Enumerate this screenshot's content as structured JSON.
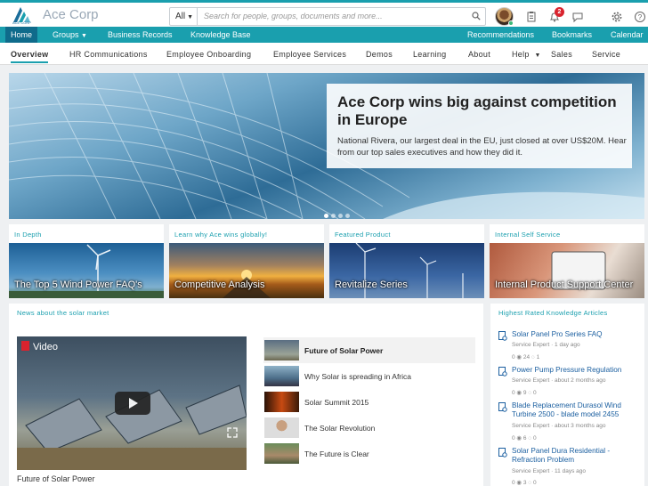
{
  "header": {
    "logo_sub": "ACE CORP",
    "brand": "Ace Corp",
    "search_scope": "All",
    "search_placeholder": "Search for people, groups, documents and more...",
    "notifications_count": "2",
    "accent": "#1a9fae"
  },
  "navbar": {
    "items": [
      "Home",
      "Groups",
      "Business Records",
      "Knowledge Base",
      "Recommendations",
      "Bookmarks",
      "Calendar"
    ]
  },
  "subnav": {
    "items": [
      "Overview",
      "HR Communications",
      "Employee Onboarding",
      "Employee Services",
      "Demos",
      "Learning",
      "About",
      "Help",
      "Sales",
      "Service"
    ]
  },
  "hero": {
    "title": "Ace Corp wins big against competition in Europe",
    "text": "National Rivera, our largest deal in the EU, just closed at over US$20M. Hear from our top sales executives and how they did it."
  },
  "tiles": [
    {
      "heading": "In Depth",
      "caption": "The Top 5 Wind Power FAQ's"
    },
    {
      "heading": "Learn why Ace wins globally!",
      "caption": "Competitive Analysis"
    },
    {
      "heading": "Featured Product",
      "caption": "Revitalize Series"
    },
    {
      "heading": "Internal Self Service",
      "caption": "Internal Product Support Center"
    }
  ],
  "news": {
    "title": "News about the solar market",
    "video_label": "Video",
    "video_caption": "Future of Solar Power",
    "videos": [
      "Future of Solar Power",
      "Why Solar is spreading in Africa",
      "Solar Summit 2015",
      "The Solar Revolution",
      "The Future is Clear"
    ]
  },
  "knowledge": {
    "title": "Highest Rated Knowledge Articles",
    "articles": [
      {
        "title": "Solar Panel Pro Series FAQ",
        "meta": "Service Expert · 1 day ago",
        "stats": "0 ◉ 24 ◌ 1"
      },
      {
        "title": "Power Pump Pressure Regulation",
        "meta": "Service Expert · about 2 months ago",
        "stats": "0 ◉ 9 ◌ 0"
      },
      {
        "title": "Blade Replacement Durasol Wind Turbine 2500 - blade model 2455",
        "meta": "Service Expert · about 3 months ago",
        "stats": "0 ◉ 6 ◌ 0"
      },
      {
        "title": "Solar Panel Dura Residential - Refraction Problem",
        "meta": "Service Expert · 11 days ago",
        "stats": "0 ◉ 3 ◌ 0"
      }
    ]
  }
}
